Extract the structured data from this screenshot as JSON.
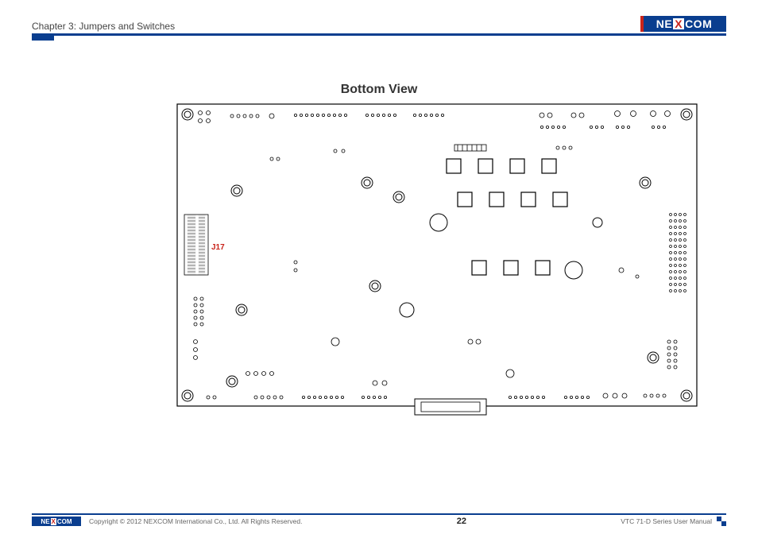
{
  "header": {
    "chapter": "Chapter 3: Jumpers and Switches",
    "brand": "NEXCOM"
  },
  "content": {
    "title": "Bottom View",
    "callout_label": "J17"
  },
  "footer": {
    "brand": "NEXCOM",
    "copyright": "Copyright © 2012 NEXCOM International Co., Ltd. All Rights Reserved.",
    "page_number": "22",
    "manual_name": "VTC 71-D Series User Manual"
  }
}
